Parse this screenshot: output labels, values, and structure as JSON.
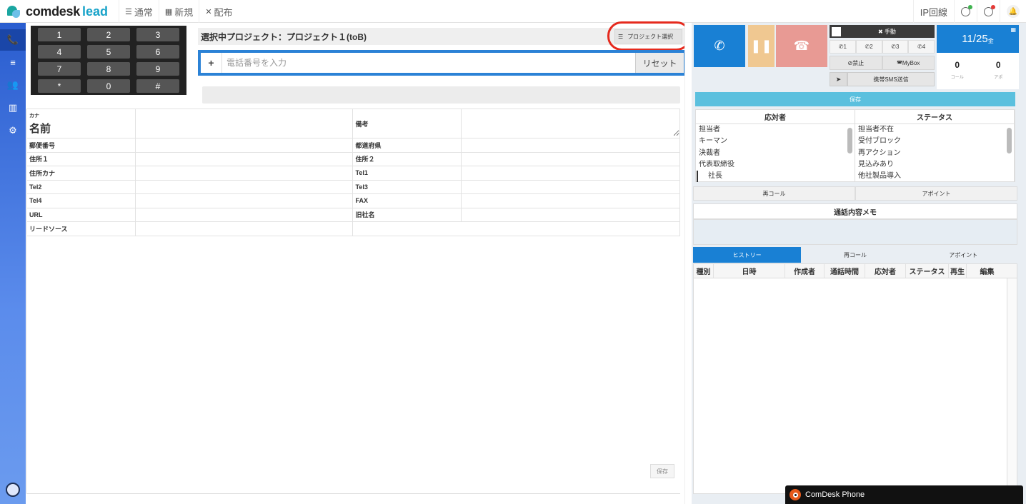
{
  "topbar": {
    "logo_part1": "comdesk",
    "logo_part2": "lead",
    "nav": [
      {
        "label": "通常",
        "icon": "list-icon"
      },
      {
        "label": "新規",
        "icon": "grid-icon"
      },
      {
        "label": "配布",
        "icon": "expand-icon"
      }
    ],
    "ip_line": "IP回線",
    "status_colors": [
      "#3fb34f",
      "#e53935"
    ]
  },
  "sidebar": {
    "items": [
      "phone-icon",
      "database-icon",
      "users-icon",
      "chart-icon",
      "gear-icon"
    ],
    "accent": "#2a5dcf"
  },
  "keypad": {
    "rows": [
      [
        "1",
        "2",
        "3"
      ],
      [
        "4",
        "5",
        "6"
      ],
      [
        "7",
        "8",
        "9"
      ],
      [
        "*",
        "0",
        "#"
      ]
    ]
  },
  "project": {
    "title": "選択中プロジェクト：プロジェクト１(toB)",
    "select_button": "プロジェクト選択"
  },
  "phone_input": {
    "plus": "+",
    "placeholder": "電話番号を入力",
    "reset": "リセット"
  },
  "info": {
    "kana_label": "カナ",
    "name_label": "名前",
    "memo_label": "備考",
    "rows": [
      [
        "郵便番号",
        "都道府県"
      ],
      [
        "住所１",
        "住所２"
      ],
      [
        "住所カナ",
        "Tel1"
      ],
      [
        "Tel2",
        "Tel3"
      ],
      [
        "Tel4",
        "FAX"
      ],
      [
        "URL",
        "旧社名"
      ],
      [
        "リードソース",
        ""
      ]
    ],
    "save": "保存"
  },
  "call_panel": {
    "call_colors": [
      "#1980d4",
      "#f0c891",
      "#e89a94"
    ],
    "manual": "手動",
    "extensions": [
      "1",
      "2",
      "3",
      "4"
    ],
    "block": "禁止",
    "mybox": "MyBox",
    "sms": "携帯SMS送信",
    "date": "11/25",
    "weekday": "金",
    "call_count": "0",
    "call_label": "コール",
    "appo_count": "0",
    "appo_label": "アポ"
  },
  "result": {
    "save": "保存",
    "responder_header": "応対者",
    "status_header": "ステータス",
    "responders": [
      "担当者",
      "キーマン",
      "決裁者",
      "代表取締役",
      "社長"
    ],
    "statuses": [
      "担当者不在",
      "受付ブロック",
      "再アクション",
      "見込みあり",
      "他社製品導入"
    ],
    "recall": "再コール",
    "appoint": "アポイント",
    "memo_title": "通話内容メモ"
  },
  "history": {
    "tabs": [
      "ヒストリー",
      "再コール",
      "アポイント"
    ],
    "columns": [
      "種別",
      "日時",
      "作成者",
      "通話時間",
      "応対者",
      "ステータス",
      "再生",
      "編集"
    ]
  },
  "footer": {
    "phone_label": "ComDesk Phone"
  }
}
